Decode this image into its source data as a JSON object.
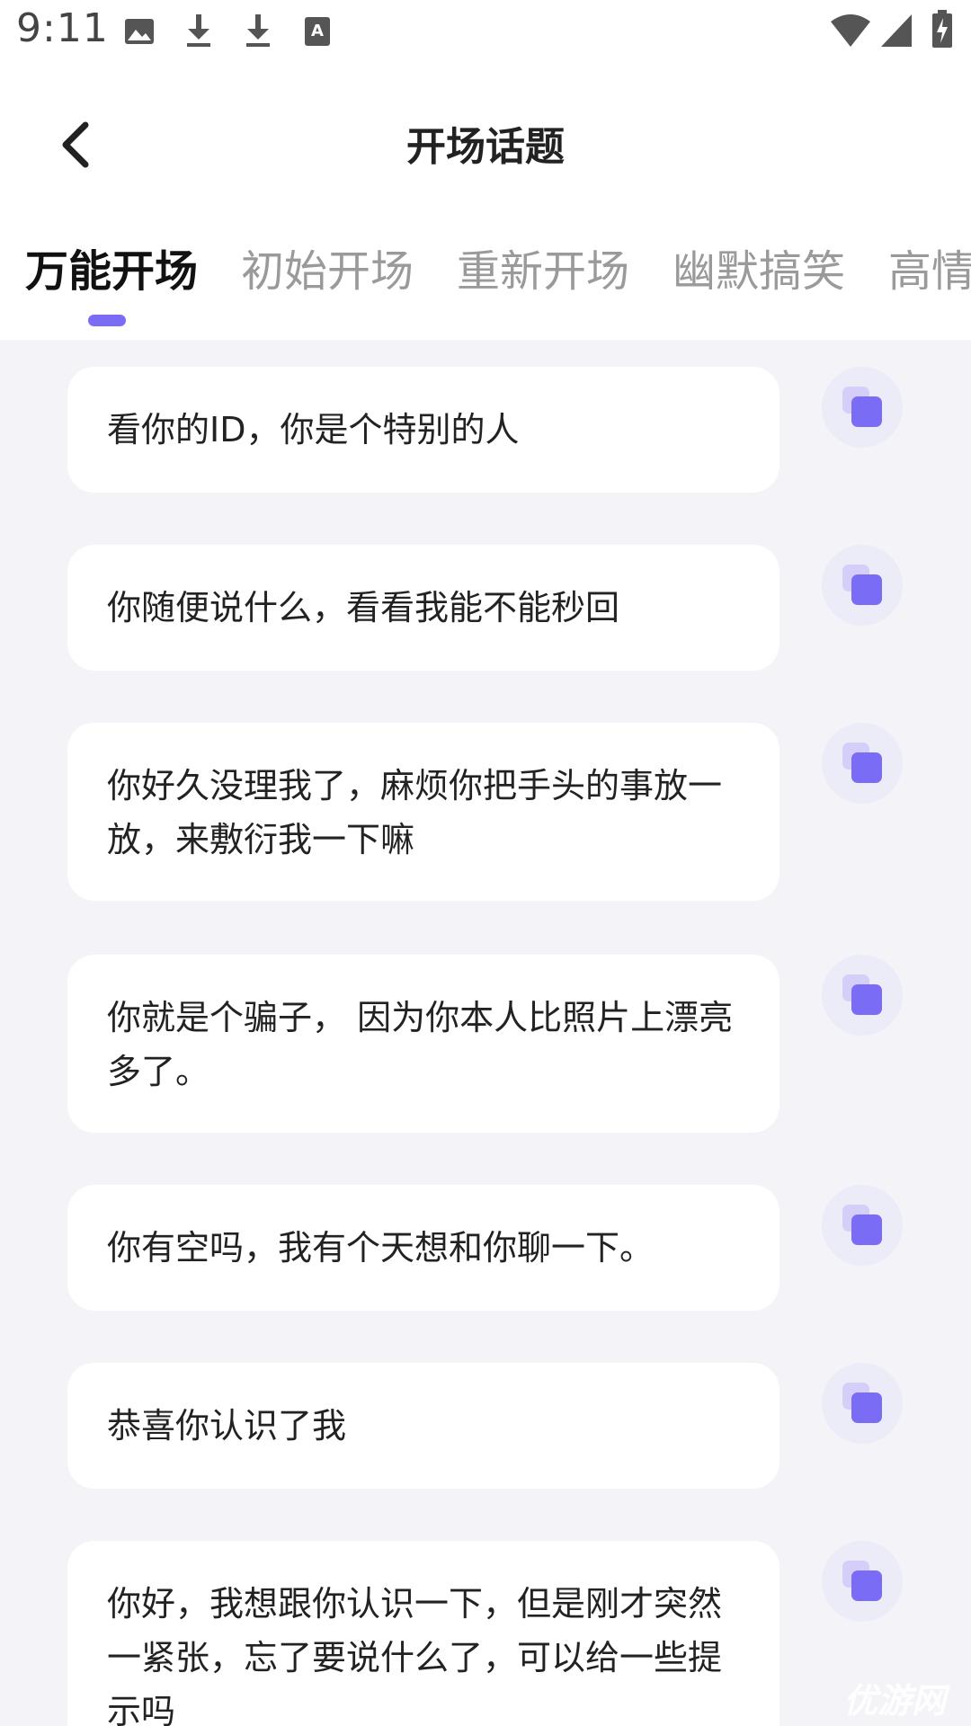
{
  "status_bar": {
    "time": "9:11",
    "icons": [
      "image-icon",
      "download-icon",
      "download-icon",
      "keyboard-a-icon"
    ],
    "right_icons": [
      "wifi-icon",
      "signal-icon",
      "battery-charging-icon"
    ]
  },
  "header": {
    "title": "开场话题",
    "back_icon": "chevron-left-icon"
  },
  "tabs": [
    {
      "label": "万能开场",
      "active": true
    },
    {
      "label": "初始开场",
      "active": false
    },
    {
      "label": "重新开场",
      "active": false
    },
    {
      "label": "幽默搞笑",
      "active": false
    },
    {
      "label": "高情",
      "active": false
    }
  ],
  "accent_color": "#7b6cf6",
  "topics": [
    {
      "text": "看你的ID，你是个特别的人"
    },
    {
      "text": "你随便说什么，看看我能不能秒回"
    },
    {
      "text": "你好久没理我了，麻烦你把手头的事放一放，来敷衍我一下嘛"
    },
    {
      "text": "你就是个骗子， 因为你本人比照片上漂亮多了。"
    },
    {
      "text": "你有空吗，我有个天想和你聊一下。"
    },
    {
      "text": "恭喜你认识了我"
    },
    {
      "text": "你好，我想跟你认识一下，但是刚才突然一紧张，忘了要说什么了，可以给一些提示吗"
    }
  ],
  "copy_icon": "copy-icon",
  "watermark": "优游网"
}
